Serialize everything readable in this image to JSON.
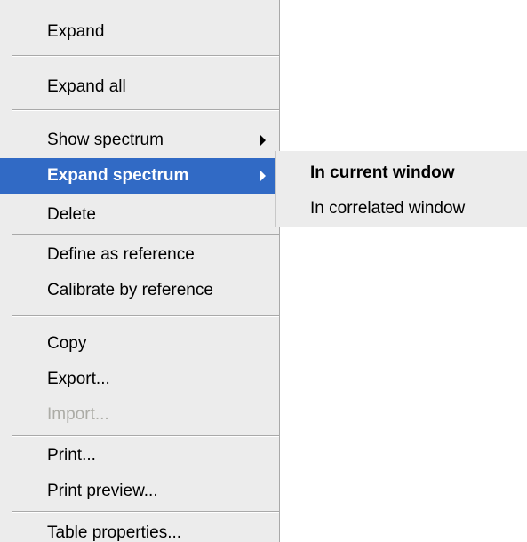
{
  "context_menu": {
    "items": [
      {
        "label": "Expand"
      },
      {
        "label": "Expand all"
      },
      {
        "label": "Show spectrum"
      },
      {
        "label": "Expand spectrum"
      },
      {
        "label": "Delete"
      },
      {
        "label": "Define as reference"
      },
      {
        "label": "Calibrate by reference"
      },
      {
        "label": "Copy"
      },
      {
        "label": "Export..."
      },
      {
        "label": "Import..."
      },
      {
        "label": "Print..."
      },
      {
        "label": "Print preview..."
      },
      {
        "label": "Table properties..."
      }
    ],
    "highlighted_item": "Expand spectrum",
    "disabled_item": "Import...",
    "submenu_arrow_icon": "triangle-right-icon",
    "colors": {
      "menu_background": "#ececec",
      "highlight_background": "#316ac5",
      "highlight_text": "#ffffff",
      "disabled_text": "#acaca6"
    }
  },
  "submenu": {
    "items": [
      {
        "label": "In current window"
      },
      {
        "label": "In correlated window"
      }
    ],
    "default_item": "In current window"
  }
}
